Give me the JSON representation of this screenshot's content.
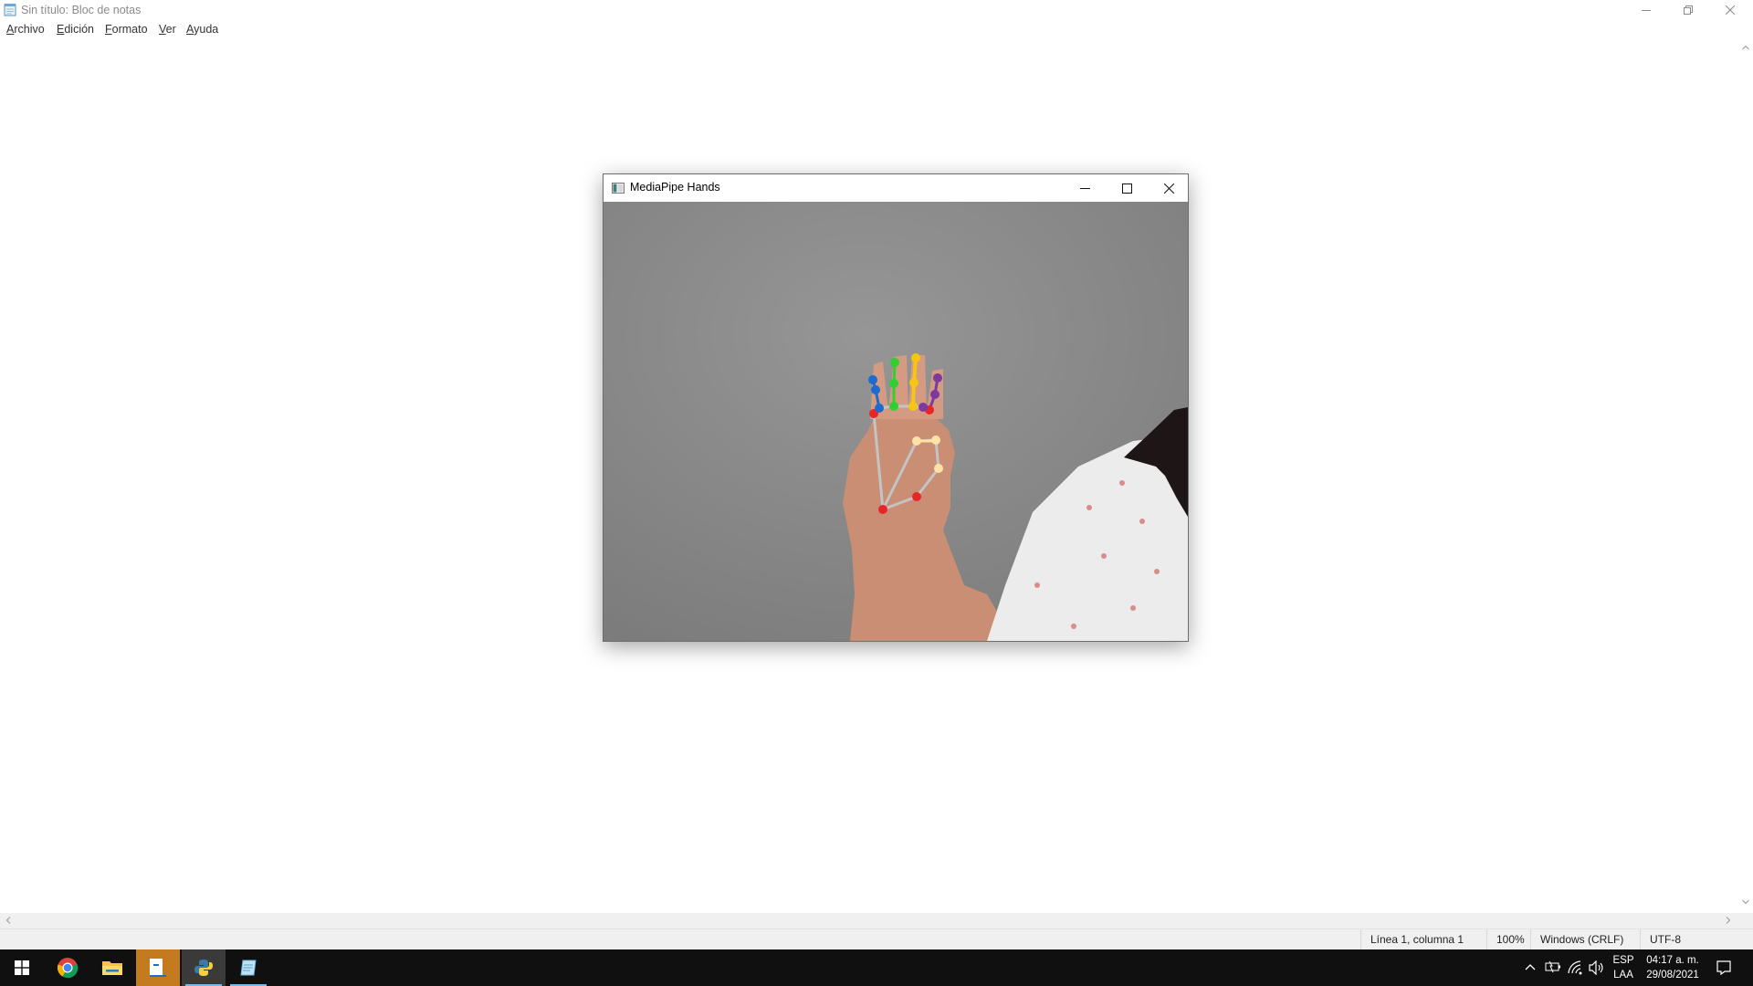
{
  "notepad": {
    "title": "Sin título: Bloc de notas",
    "menu": [
      {
        "label": "Archivo",
        "accel": "A",
        "rest": "rchivo"
      },
      {
        "label": "Edición",
        "accel": "E",
        "rest": "dición"
      },
      {
        "label": "Formato",
        "accel": "F",
        "rest": "ormato"
      },
      {
        "label": "Ver",
        "accel": "V",
        "rest": "er"
      },
      {
        "label": "Ayuda",
        "accel": "A",
        "rest": "yuda"
      }
    ],
    "editor_text": "",
    "status": {
      "position": "Línea 1, columna 1",
      "zoom": "100%",
      "line_ending": "Windows (CRLF)",
      "encoding": "UTF-8"
    }
  },
  "mediapipe": {
    "title": "MediaPipe Hands",
    "colors": {
      "background": "#8d8d8d",
      "connection": "#c4c4c4",
      "wrist": "#e8262a",
      "thumb": "#ffe3a6",
      "index": "#1c6bd1",
      "middle": "#2fd02f",
      "ring": "#f5c613",
      "pinky": "#7c3aa0"
    }
  },
  "taskbar": {
    "apps": [
      {
        "name": "chrome",
        "active": false
      },
      {
        "name": "file-explorer",
        "active": false
      },
      {
        "name": "pictures",
        "active": false
      },
      {
        "name": "python",
        "active": true
      },
      {
        "name": "notepad",
        "active": true
      }
    ],
    "language_top": "ESP",
    "language_bottom": "LAA",
    "time": "04:17 a. m.",
    "date": "29/08/2021"
  }
}
